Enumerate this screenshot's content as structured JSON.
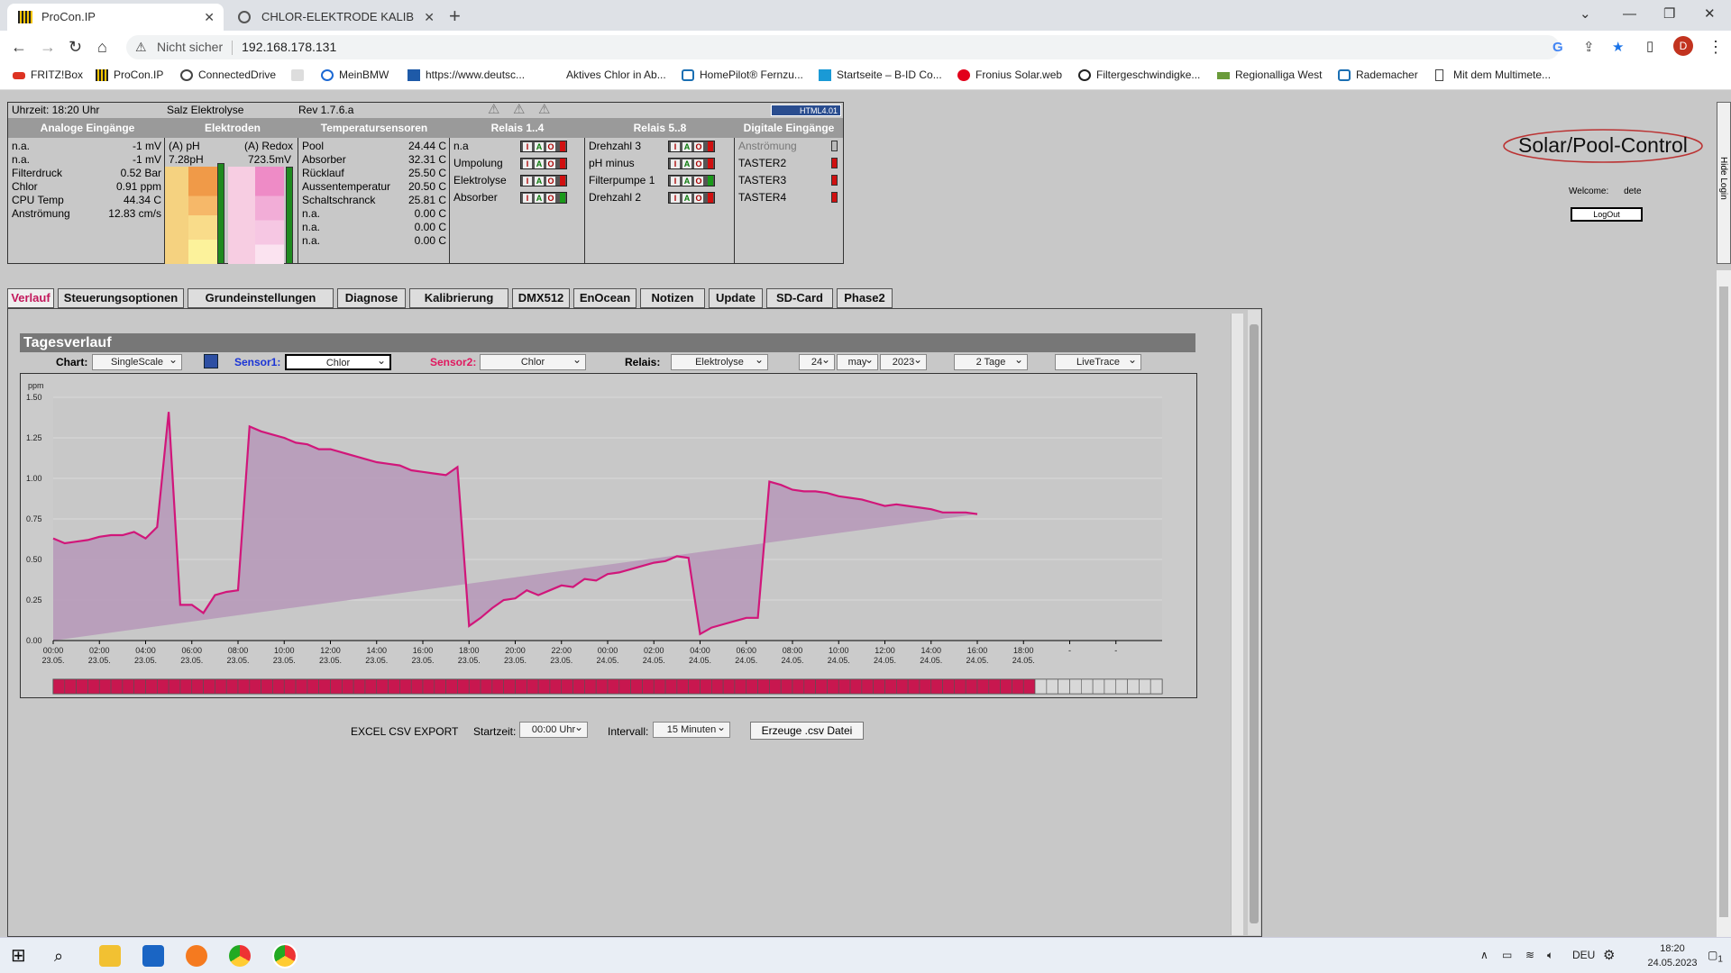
{
  "browser": {
    "tabs": [
      {
        "title": "ProCon.IP",
        "active": true
      },
      {
        "title": "CHLOR-ELEKTRODE KALIBRIEREN",
        "active": false
      }
    ],
    "new_tab": "+",
    "address": {
      "security": "Nicht sicher",
      "url": "192.168.178.131"
    },
    "bookmarks": [
      "FRITZ!Box",
      "ProCon.IP",
      "ConnectedDrive",
      "",
      "MeinBMW",
      "https://www.deutsc...",
      "Aktives Chlor in Ab...",
      "HomePilot® Fernzu...",
      "Startseite – B-ID Co...",
      "Fronius Solar.web",
      "Filtergeschwindigke...",
      "Regionalliga West",
      "Rademacher",
      "Mit dem Multimete..."
    ],
    "profile_initial": "D"
  },
  "panel": {
    "time": "Uhrzeit: 18:20 Uhr",
    "mode": "Salz Elektrolyse",
    "rev": "Rev 1.7.6.a",
    "badge": "HTML4.01",
    "headers": [
      "Analoge Eingänge",
      "Elektroden",
      "Temperatursensoren",
      "Relais 1..4",
      "Relais 5..8",
      "Digitale Eingänge"
    ],
    "analog": [
      {
        "name": "n.a.",
        "value": "-1 mV"
      },
      {
        "name": "n.a.",
        "value": "-1 mV"
      },
      {
        "name": "Filterdruck",
        "value": "0.52 Bar"
      },
      {
        "name": "Chlor",
        "value": "0.91 ppm"
      },
      {
        "name": "CPU Temp",
        "value": "44.34 C"
      },
      {
        "name": "Anströmung",
        "value": "12.83 cm/s"
      }
    ],
    "electrodes": {
      "ph_label": "(A) pH",
      "ph_value": "7.28pH",
      "redox_label": "(A) Redox",
      "redox_value": "723.5mV"
    },
    "temps": [
      {
        "name": "Pool",
        "value": "24.44 C"
      },
      {
        "name": "Absorber",
        "value": "32.31 C"
      },
      {
        "name": "Rücklauf",
        "value": "25.50 C"
      },
      {
        "name": "Aussentemperatur",
        "value": "20.50 C"
      },
      {
        "name": "Schaltschranck",
        "value": "25.81 C"
      },
      {
        "name": "n.a.",
        "value": "0.00 C"
      },
      {
        "name": "n.a.",
        "value": "0.00 C"
      },
      {
        "name": "n.a.",
        "value": "0.00 C"
      }
    ],
    "relais1": [
      {
        "name": "n.a",
        "state": "off"
      },
      {
        "name": "Umpolung",
        "state": "off"
      },
      {
        "name": "Elektrolyse",
        "state": "off"
      },
      {
        "name": "Absorber",
        "state": "on"
      }
    ],
    "relais2": [
      {
        "name": "Drehzahl 3",
        "state": "off"
      },
      {
        "name": "pH minus",
        "state": "off"
      },
      {
        "name": "Filterpumpe 1",
        "state": "on"
      },
      {
        "name": "Drehzahl 2",
        "state": "off"
      }
    ],
    "iao": [
      "I",
      "A",
      "O"
    ],
    "digital": [
      {
        "name": "Anströmung",
        "state": "grey"
      },
      {
        "name": "TASTER2",
        "state": "red"
      },
      {
        "name": "TASTER3",
        "state": "red"
      },
      {
        "name": "TASTER4",
        "state": "red"
      }
    ]
  },
  "logo": "Solar/Pool-Control",
  "login": {
    "welcome": "Welcome:",
    "user": "dete",
    "logout": "LogOut",
    "hide": "Hide Login"
  },
  "tabs": [
    "Verlauf",
    "Steuerungsoptionen",
    "Grundeinstellungen",
    "Diagnose",
    "Kalibrierung",
    "DMX512",
    "EnOcean",
    "Notizen",
    "Update",
    "SD-Card",
    "Phase2"
  ],
  "tagesverlauf": {
    "title": "Tagesverlauf",
    "chart_label": "Chart:",
    "chart_value": "SingleScale",
    "sensor1_label": "Sensor1:",
    "sensor1_value": "Chlor",
    "sensor2_label": "Sensor2:",
    "sensor2_value": "Chlor",
    "relais_label": "Relais:",
    "relais_value": "Elektrolyse",
    "day": "24",
    "month": "may",
    "year": "2023",
    "range": "2 Tage",
    "trace": "LiveTrace"
  },
  "chart_data": {
    "type": "area",
    "ylabel": "ppm",
    "ylim": [
      0,
      1.5
    ],
    "yticks": [
      "0.00",
      "0.25",
      "0.50",
      "0.75",
      "1.00",
      "1.25",
      "1.50"
    ],
    "xticks": [
      {
        "time": "00:00",
        "date": "23.05."
      },
      {
        "time": "02:00",
        "date": "23.05."
      },
      {
        "time": "04:00",
        "date": "23.05."
      },
      {
        "time": "06:00",
        "date": "23.05."
      },
      {
        "time": "08:00",
        "date": "23.05."
      },
      {
        "time": "10:00",
        "date": "23.05."
      },
      {
        "time": "12:00",
        "date": "23.05."
      },
      {
        "time": "14:00",
        "date": "23.05."
      },
      {
        "time": "16:00",
        "date": "23.05."
      },
      {
        "time": "18:00",
        "date": "23.05."
      },
      {
        "time": "20:00",
        "date": "23.05."
      },
      {
        "time": "22:00",
        "date": "23.05."
      },
      {
        "time": "00:00",
        "date": "24.05."
      },
      {
        "time": "02:00",
        "date": "24.05."
      },
      {
        "time": "04:00",
        "date": "24.05."
      },
      {
        "time": "06:00",
        "date": "24.05."
      },
      {
        "time": "08:00",
        "date": "24.05."
      },
      {
        "time": "10:00",
        "date": "24.05."
      },
      {
        "time": "12:00",
        "date": "24.05."
      },
      {
        "time": "14:00",
        "date": "24.05."
      },
      {
        "time": "16:00",
        "date": "24.05."
      },
      {
        "time": "18:00",
        "date": "24.05."
      },
      {
        "time": "-",
        "date": ""
      },
      {
        "time": "-",
        "date": ""
      }
    ],
    "x_hours": [
      0,
      0.5,
      1,
      1.5,
      2,
      2.5,
      3,
      3.5,
      4,
      4.5,
      5,
      5.5,
      6,
      6.5,
      7,
      7.5,
      8,
      8.5,
      9,
      9.5,
      10,
      10.5,
      11,
      11.5,
      12,
      12.5,
      13,
      13.5,
      14,
      14.5,
      15,
      15.5,
      16,
      16.5,
      17,
      17.5,
      18,
      18.5,
      19,
      19.5,
      20,
      20.5,
      21,
      21.5,
      22,
      22.5,
      23,
      23.5,
      24,
      24.5,
      25,
      25.5,
      26,
      26.5,
      27,
      27.5,
      28,
      28.5,
      29,
      29.5,
      30,
      30.5,
      31,
      31.5,
      32,
      32.5,
      33,
      33.5,
      34,
      34.5,
      35,
      35.5,
      36,
      36.5,
      37,
      37.5,
      38,
      38.5,
      39,
      39.5,
      40,
      40.5,
      41,
      41.5,
      42
    ],
    "values": [
      0.63,
      0.6,
      0.61,
      0.62,
      0.64,
      0.65,
      0.65,
      0.67,
      0.63,
      0.7,
      1.41,
      0.22,
      0.22,
      0.17,
      0.28,
      0.3,
      0.31,
      1.32,
      1.29,
      1.27,
      1.25,
      1.22,
      1.21,
      1.18,
      1.18,
      1.16,
      1.14,
      1.12,
      1.1,
      1.09,
      1.08,
      1.05,
      1.04,
      1.03,
      1.02,
      1.07,
      0.09,
      0.14,
      0.2,
      0.25,
      0.26,
      0.31,
      0.28,
      0.31,
      0.34,
      0.33,
      0.38,
      0.37,
      0.41,
      0.42,
      0.44,
      0.46,
      0.48,
      0.49,
      0.52,
      0.51,
      0.04,
      0.08,
      0.1,
      0.12,
      0.14,
      0.14,
      0.98,
      0.96,
      0.93,
      0.92,
      0.92,
      0.91,
      0.89,
      0.88,
      0.87,
      0.85,
      0.83,
      0.84,
      0.83,
      0.82,
      0.81,
      0.79,
      0.79,
      0.79,
      0.78
    ],
    "relay_bar": {
      "total": 96,
      "active": 85,
      "active_color": "#c8174f"
    }
  },
  "export": {
    "label": "EXCEL CSV EXPORT",
    "start_label": "Startzeit:",
    "start_value": "00:00 Uhr",
    "interval_label": "Intervall:",
    "interval_value": "15 Minuten",
    "button": "Erzeuge .csv Datei"
  },
  "taskbar": {
    "lang": "DEU",
    "time": "18:20",
    "date": "24.05.2023",
    "notif": "1"
  },
  "colors": {
    "line": "#d1167a",
    "fill": "#b79ab9",
    "bg": "#c8c8c8"
  }
}
